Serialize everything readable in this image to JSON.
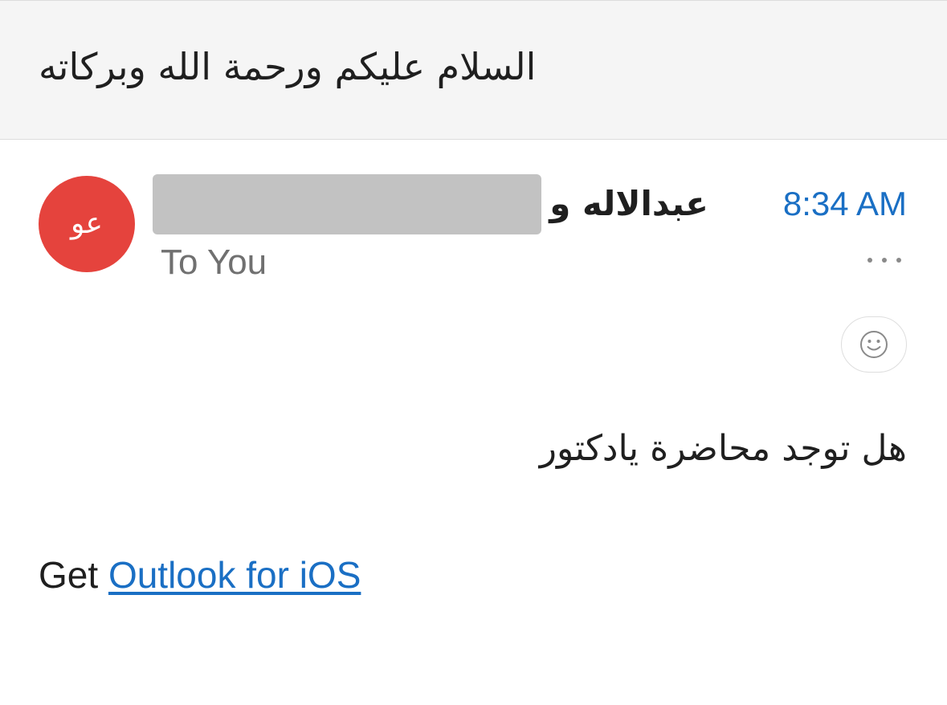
{
  "email": {
    "subject": "السلام عليكم ورحمة الله وبركاته",
    "sender": {
      "initials": "عو",
      "avatar_color": "#e5433d",
      "name_visible": "عبدالاله و"
    },
    "recipient_line": "To You",
    "time": "8:34 AM",
    "accent_color": "#1a6fc4",
    "more_icon": "more-horizontal-icon",
    "reaction_icon": "smiley-icon",
    "body": "هل توجد محاضرة يادكتور",
    "signature": {
      "prefix": "Get ",
      "link_text": "Outlook for iOS"
    }
  }
}
